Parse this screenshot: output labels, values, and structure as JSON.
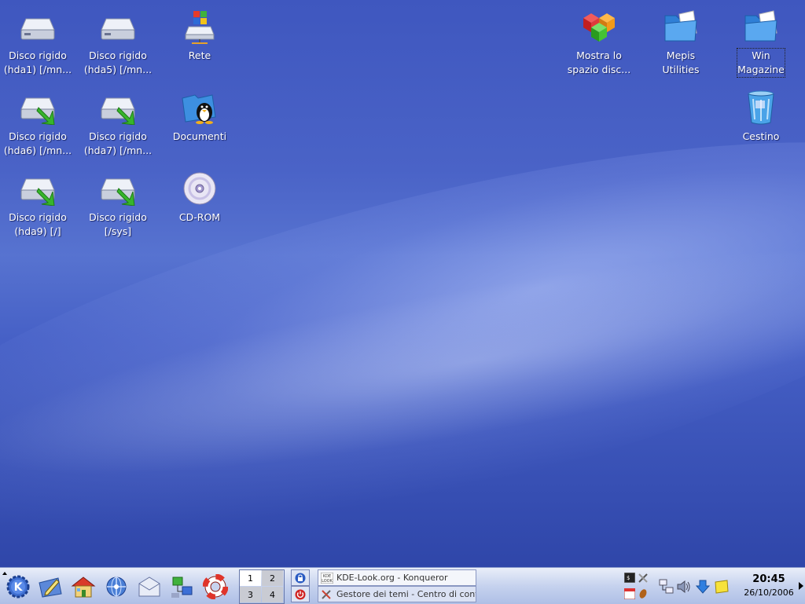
{
  "desktop": {
    "icons": [
      {
        "line1": "Disco rigido",
        "line2": "(hda1) [/mn..."
      },
      {
        "line1": "Disco rigido",
        "line2": "(hda5) [/mn..."
      },
      {
        "line1": "Rete",
        "line2": ""
      },
      {
        "line1": "Disco rigido",
        "line2": "(hda6) [/mn..."
      },
      {
        "line1": "Disco rigido",
        "line2": "(hda7) [/mn..."
      },
      {
        "line1": "Documenti",
        "line2": ""
      },
      {
        "line1": "Disco rigido",
        "line2": "(hda9) [/]"
      },
      {
        "line1": "Disco rigido",
        "line2": "[/sys]"
      },
      {
        "line1": "CD-ROM",
        "line2": ""
      },
      {
        "line1": "Mostra lo",
        "line2": "spazio disc..."
      },
      {
        "line1": "Mepis",
        "line2": "Utilities"
      },
      {
        "line1": "Win",
        "line2": "Magazine"
      },
      {
        "line1": "Cestino",
        "line2": ""
      }
    ]
  },
  "taskbar": {
    "pager": [
      "1",
      "2",
      "3",
      "4"
    ],
    "tasks": [
      {
        "label": "KDE-Look.org - Konqueror",
        "icon": "kde-look-icon"
      },
      {
        "label": "Gestore dei temi - Centro di controllo",
        "icon": "tools-icon"
      }
    ],
    "clock": {
      "time": "20:45",
      "date": "26/10/2006"
    }
  },
  "colors": {
    "desktop": "#4a63c7",
    "taskbar": "#c6d2ee",
    "folder": "#3d8fe0"
  }
}
